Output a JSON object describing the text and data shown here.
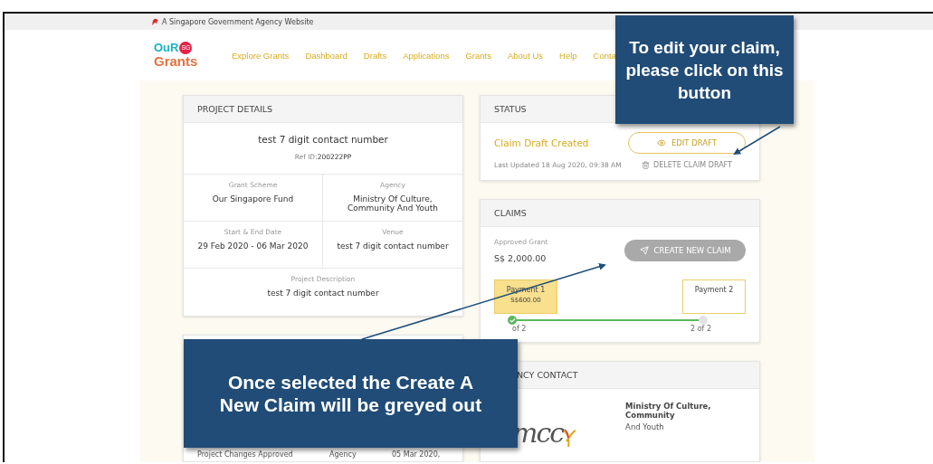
{
  "banner": {
    "text": "A Singapore Government Agency Website"
  },
  "logo": {
    "top": "OuR",
    "badge": "SG",
    "bottom": "Grants"
  },
  "nav": [
    {
      "label": "Explore Grants"
    },
    {
      "label": "Dashboard"
    },
    {
      "label": "Drafts"
    },
    {
      "label": "Applications"
    },
    {
      "label": "Grants"
    },
    {
      "label": "About Us"
    },
    {
      "label": "Help"
    },
    {
      "label": "Conta"
    }
  ],
  "project_details": {
    "title": "PROJECT DETAILS",
    "name": "test 7 digit contact number",
    "ref": "Ref ID:**200222PP**",
    "fields": [
      {
        "label": "Grant Scheme",
        "value": "Our Singapore Fund"
      },
      {
        "label": "Agency",
        "value": "Ministry Of Culture, Community And Youth"
      },
      {
        "label": "Start & End Date",
        "value": "29 Feb 2020 - 06 Mar 2020"
      },
      {
        "label": "Venue",
        "value": "test 7 digit contact number"
      }
    ],
    "description": {
      "label": "Project Description",
      "value": "test 7 digit contact number"
    }
  },
  "history": {
    "row": [
      "Project Changes Approved",
      "Agency",
      "05 Mar 2020,"
    ]
  },
  "status": {
    "title": "STATUS",
    "state": "Claim Draft Created",
    "updated": "Last Updated 18 Aug 2020, 09:38 AM",
    "edit_button": "EDIT DRAFT",
    "delete_button": "DELETE CLAIM DRAFT"
  },
  "claims": {
    "title": "CLAIMS",
    "approved_label": "Approved Grant",
    "approved_amount": "S$ 2,000.00",
    "create_button": {
      "label": "CREATE NEW CLAIM",
      "disabled": true
    },
    "payments": [
      {
        "name": "Payment 1",
        "amount": "S$600.00",
        "completed": true,
        "step": "of 2"
      },
      {
        "name": "Payment 2",
        "completed": false,
        "step": "2 of 2"
      }
    ]
  },
  "agency_contact": {
    "title": "NCY CONTACT",
    "logo": "mcc",
    "name": "Ministry Of Culture, Community",
    "line": "And Youth"
  },
  "callouts": [
    {
      "text": "To edit your claim, please click on this button"
    },
    {
      "text": "Once selected the Create A New Claim will be greyed out"
    }
  ]
}
